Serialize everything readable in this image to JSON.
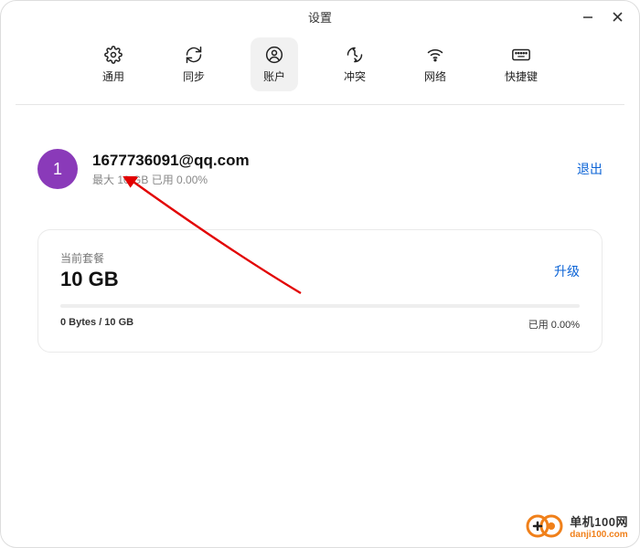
{
  "window": {
    "title": "设置"
  },
  "tabs": {
    "general": "通用",
    "sync": "同步",
    "account": "账户",
    "conflict": "冲突",
    "network": "网络",
    "shortcut": "快捷键"
  },
  "account": {
    "avatar_initial": "1",
    "email": "1677736091@qq.com",
    "subline": "最大 10 GB 已用 0.00%",
    "logout": "退出"
  },
  "plan": {
    "label": "当前套餐",
    "size": "10 GB",
    "upgrade": "升级",
    "usage_left": "0 Bytes / 10 GB",
    "usage_right": "已用 0.00%"
  },
  "watermark": {
    "top": "单机100网",
    "bottom": "danji100.com"
  }
}
